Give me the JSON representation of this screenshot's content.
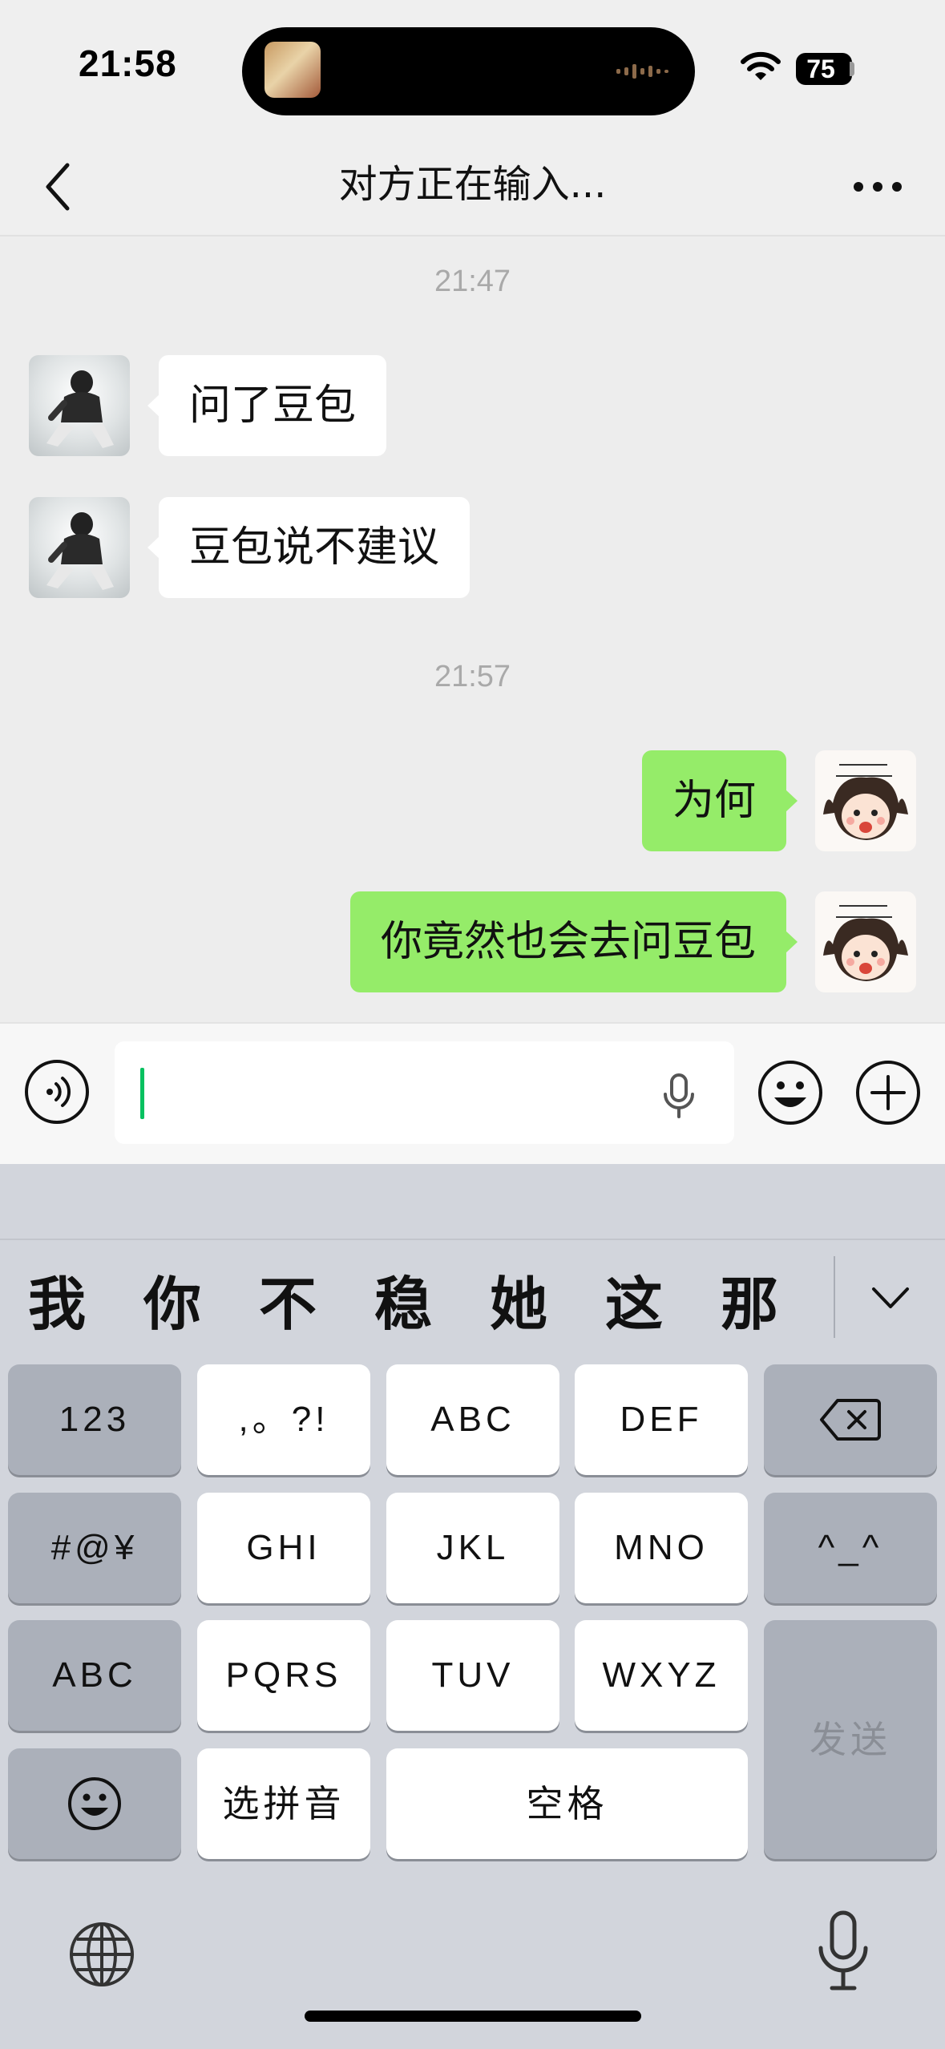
{
  "status_bar": {
    "time": "21:58",
    "battery": "75"
  },
  "nav": {
    "title": "对方正在输入...",
    "back_icon": "chevron-left-icon",
    "more_icon": "ellipsis-icon"
  },
  "chat": {
    "timestamps": [
      "21:47",
      "21:57"
    ],
    "messages": [
      {
        "side": "in",
        "text": "问了豆包"
      },
      {
        "side": "in",
        "text": "豆包说不建议"
      },
      {
        "side": "out",
        "text": "为何"
      },
      {
        "side": "out",
        "text": "你竟然也会去问豆包"
      }
    ]
  },
  "input": {
    "value": "",
    "voice_icon": "voice-wave-icon",
    "mic_icon": "microphone-icon",
    "emoji_icon": "smiley-icon",
    "plus_icon": "plus-circle-icon"
  },
  "keyboard": {
    "candidates": [
      "我",
      "你",
      "不",
      "稳",
      "她",
      "这",
      "那"
    ],
    "rows": [
      [
        "123",
        ",。?!",
        "ABC",
        "DEF"
      ],
      [
        "#@¥",
        "GHI",
        "JKL",
        "MNO",
        "^_^"
      ],
      [
        "ABC",
        "PQRS",
        "TUV",
        "WXYZ"
      ],
      [
        "选拼音",
        "空格"
      ]
    ],
    "send": "发送",
    "icons": {
      "delete": "backspace-icon",
      "emoji": "smiley-icon",
      "globe": "globe-icon",
      "dictation": "microphone-icon",
      "collapse": "chevron-down-icon"
    }
  },
  "colors": {
    "accent": "#07c160",
    "outgoing_bubble": "#95ec69",
    "incoming_bubble": "#ffffff",
    "keyboard_bg": "#d2d5dc"
  }
}
